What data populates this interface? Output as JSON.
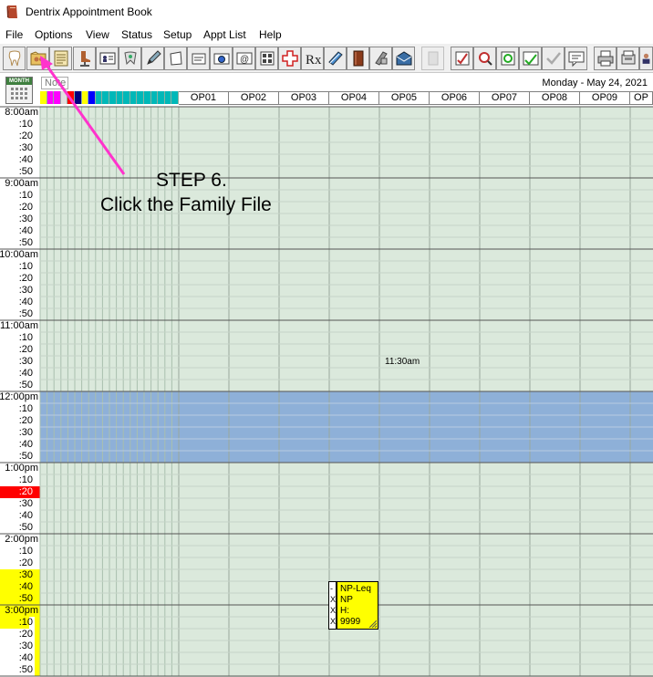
{
  "window": {
    "title": "Dentrix Appointment Book"
  },
  "menu": [
    "File",
    "Options",
    "View",
    "Status",
    "Setup",
    "Appt List",
    "Help"
  ],
  "toolbar": {
    "buttons": [
      "tooth-icon",
      "family-file-icon",
      "ledger-icon",
      "chair-icon",
      "patient-card-icon",
      "perio-icon",
      "pen-icon",
      "document-icon",
      "letter-icon",
      "camera-icon",
      "email-icon",
      "grid-icon",
      "medical-cross-icon",
      "rx-icon",
      "notepad-icon",
      "book-icon",
      "phone-icon",
      "mail-icon",
      "disabled-icon",
      "checklist-icon",
      "search-icon",
      "image-icon",
      "appt-icon",
      "check-icon",
      "chat-icon",
      "print-icon",
      "fax-icon",
      "person-icon"
    ]
  },
  "header": {
    "note_label": "Note",
    "month_label": "MONTH",
    "date": "Monday - May 24, 2021",
    "operatories": [
      "OP01",
      "OP02",
      "OP03",
      "OP04",
      "OP05",
      "OP06",
      "OP07",
      "OP08",
      "OP09",
      "OP"
    ]
  },
  "colors": {
    "schedule_bg": "#dbe9dc",
    "lunch_block": "#8eb0d8",
    "current_time": "#ff0000",
    "highlight": "#ffff00",
    "annotation_arrow": "#ff33cc"
  },
  "color_strip": [
    "#ffff00",
    "#ff00ff",
    "#ff00ff",
    "#e0e0e0",
    "#ff0000",
    "#000080",
    "#ffff00",
    "#0000ff",
    "#00b8b8",
    "#00b8b8",
    "#00b8b8",
    "#00b8b8",
    "#00b8b8",
    "#00b8b8",
    "#00b8b8",
    "#00b8b8",
    "#00b8b8",
    "#00b8b8",
    "#00b8b8",
    "#00b8b8"
  ],
  "time_slots": [
    "8:00am",
    ":10",
    ":20",
    ":30",
    ":40",
    ":50",
    "9:00am",
    ":10",
    ":20",
    ":30",
    ":40",
    ":50",
    "10:00am",
    ":10",
    ":20",
    ":30",
    ":40",
    ":50",
    "11:00am",
    ":10",
    ":20",
    ":30",
    ":40",
    ":50",
    "12:00pm",
    ":10",
    ":20",
    ":30",
    ":40",
    ":50",
    "1:00pm",
    ":10",
    ":20",
    ":30",
    ":40",
    ":50",
    "2:00pm",
    ":10",
    ":20",
    ":30",
    ":40",
    ":50",
    "3:00pm",
    ":10",
    ":20",
    ":30",
    ":40",
    ":50"
  ],
  "time_marker": "11:30am",
  "appointment": {
    "lines": [
      "NP-Leq",
      "NP",
      "H:",
      "9999"
    ],
    "checks": [
      "-",
      "X",
      "X",
      "X"
    ]
  },
  "annotation": {
    "step": "STEP 6.",
    "text": "Click the Family File"
  }
}
